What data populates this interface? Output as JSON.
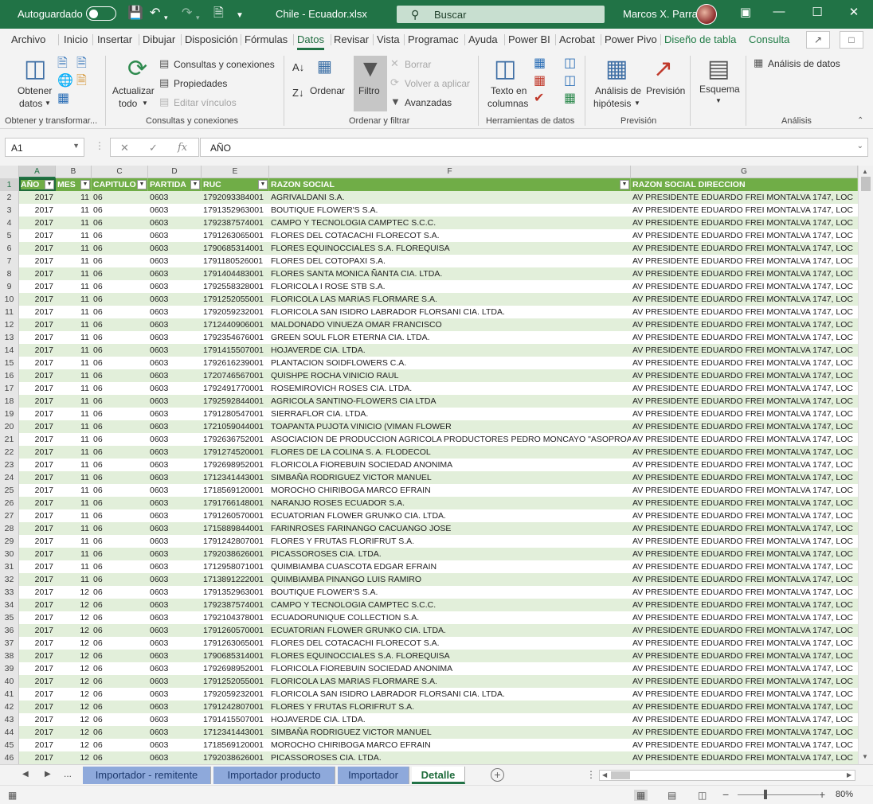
{
  "titlebar": {
    "autosave_label": "Autoguardado",
    "filename": "Chile - Ecuador.xlsx",
    "search_placeholder": "Buscar",
    "user_name": "Marcos X. Parra"
  },
  "ribbon_tabs": [
    "Archivo",
    "Inicio",
    "Insertar",
    "Dibujar",
    "Disposición",
    "Fórmulas",
    "Datos",
    "Revisar",
    "Vista",
    "Programac",
    "Ayuda",
    "Power BI",
    "Acrobat",
    "Power Pivo",
    "Diseño de tabla",
    "Consulta"
  ],
  "active_tab": "Datos",
  "ribbon": {
    "obtener_datos": "Obtener",
    "obtener_datos_2": "datos",
    "group_obtener": "Obtener y transformar...",
    "actualizar": "Actualizar",
    "actualizar_2": "todo",
    "consultas_conexiones": "Consultas y conexiones",
    "propiedades": "Propiedades",
    "editar_vinculos": "Editar vínculos",
    "group_consultas": "Consultas y conexiones",
    "ordenar": "Ordenar",
    "filtro": "Filtro",
    "borrar": "Borrar",
    "volver_aplicar": "Volver a aplicar",
    "avanzadas": "Avanzadas",
    "group_ordenar": "Ordenar y filtrar",
    "texto_columnas": "Texto en",
    "texto_columnas_2": "columnas",
    "group_herramientas": "Herramientas de datos",
    "analisis_hipotesis": "Análisis de",
    "analisis_hipotesis_2": "hipótesis",
    "prevision": "Previsión",
    "group_prevision": "Previsión",
    "esquema": "Esquema",
    "analisis_datos": "Análisis de datos",
    "group_analisis": "Análisis"
  },
  "formula_bar": {
    "name_box": "A1",
    "formula": "AÑO",
    "fx": "fx"
  },
  "columns": [
    {
      "letter": "A",
      "header": "AÑO"
    },
    {
      "letter": "B",
      "header": "MES"
    },
    {
      "letter": "C",
      "header": "CAPITULO"
    },
    {
      "letter": "D",
      "header": "PARTIDA"
    },
    {
      "letter": "E",
      "header": "RUC"
    },
    {
      "letter": "F",
      "header": "RAZON SOCIAL"
    },
    {
      "letter": "G",
      "header": "RAZON SOCIAL DIRECCION"
    }
  ],
  "address": "AV  PRESIDENTE EDUARDO FREI MONTALVA 1747, LOC",
  "rows": [
    [
      "2017",
      "11",
      "06",
      "0603",
      "1792093384001",
      "AGRIVALDANI S.A."
    ],
    [
      "2017",
      "11",
      "06",
      "0603",
      "1791352963001",
      "BOUTIQUE FLOWER'S S.A."
    ],
    [
      "2017",
      "11",
      "06",
      "0603",
      "1792387574001",
      "CAMPO Y TECNOLOGIA CAMPTEC S.C.C."
    ],
    [
      "2017",
      "11",
      "06",
      "0603",
      "1791263065001",
      "FLORES DEL COTACACHI FLORECOT S.A."
    ],
    [
      "2017",
      "11",
      "06",
      "0603",
      "1790685314001",
      "FLORES EQUINOCCIALES S.A. FLOREQUISA"
    ],
    [
      "2017",
      "11",
      "06",
      "0603",
      "1791180526001",
      "FLORES DEL COTOPAXI S.A."
    ],
    [
      "2017",
      "11",
      "06",
      "0603",
      "1791404483001",
      "FLORES SANTA MONICA ÑANTA CIA. LTDA."
    ],
    [
      "2017",
      "11",
      "06",
      "0603",
      "1792558328001",
      "FLORICOLA I ROSE STB S.A."
    ],
    [
      "2017",
      "11",
      "06",
      "0603",
      "1791252055001",
      "FLORICOLA LAS MARIAS FLORMARE S.A."
    ],
    [
      "2017",
      "11",
      "06",
      "0603",
      "1792059232001",
      "FLORICOLA SAN ISIDRO LABRADOR FLORSANI CIA. LTDA."
    ],
    [
      "2017",
      "11",
      "06",
      "0603",
      "1712440906001",
      "MALDONADO VINUEZA OMAR FRANCISCO"
    ],
    [
      "2017",
      "11",
      "06",
      "0603",
      "1792354676001",
      "GREEN SOUL FLOR ETERNA CIA. LTDA."
    ],
    [
      "2017",
      "11",
      "06",
      "0603",
      "1791415507001",
      "HOJAVERDE CIA. LTDA."
    ],
    [
      "2017",
      "11",
      "06",
      "0603",
      "1792616239001",
      "PLANTACION SOIDFLOWERS C.A."
    ],
    [
      "2017",
      "11",
      "06",
      "0603",
      "1720746567001",
      "QUISHPE ROCHA VINICIO RAUL"
    ],
    [
      "2017",
      "11",
      "06",
      "0603",
      "1792491770001",
      "ROSEMIROVICH ROSES CIA. LTDA."
    ],
    [
      "2017",
      "11",
      "06",
      "0603",
      "1792592844001",
      "AGRICOLA SANTINO-FLOWERS CIA LTDA"
    ],
    [
      "2017",
      "11",
      "06",
      "0603",
      "1791280547001",
      "SIERRAFLOR CIA. LTDA."
    ],
    [
      "2017",
      "11",
      "06",
      "0603",
      "1721059044001",
      "TOAPANTA PUJOTA VINICIO (VIMAN FLOWER"
    ],
    [
      "2017",
      "11",
      "06",
      "0603",
      "1792636752001",
      "ASOCIACION DE PRODUCCION AGRICOLA PRODUCTORES PEDRO MONCAYO \"ASOPROAGR"
    ],
    [
      "2017",
      "11",
      "06",
      "0603",
      "1791274520001",
      "FLORES DE LA COLINA S. A. FLODECOL"
    ],
    [
      "2017",
      "11",
      "06",
      "0603",
      "1792698952001",
      "FLORICOLA FIOREBUIN SOCIEDAD ANONIMA"
    ],
    [
      "2017",
      "11",
      "06",
      "0603",
      "1712341443001",
      "SIMBAÑA RODRIGUEZ VICTOR MANUEL"
    ],
    [
      "2017",
      "11",
      "06",
      "0603",
      "1718569120001",
      "MOROCHO CHIRIBOGA MARCO EFRAIN"
    ],
    [
      "2017",
      "11",
      "06",
      "0603",
      "1791766148001",
      "NARANJO ROSES ECUADOR S.A."
    ],
    [
      "2017",
      "11",
      "06",
      "0603",
      "1791260570001",
      "ECUATORIAN FLOWER GRUNKO CIA. LTDA."
    ],
    [
      "2017",
      "11",
      "06",
      "0603",
      "1715889844001",
      "FARINROSES FARINANGO CACUANGO JOSE"
    ],
    [
      "2017",
      "11",
      "06",
      "0603",
      "1791242807001",
      "FLORES Y FRUTAS FLORIFRUT S.A."
    ],
    [
      "2017",
      "11",
      "06",
      "0603",
      "1792038626001",
      "PICASSOROSES CIA. LTDA."
    ],
    [
      "2017",
      "11",
      "06",
      "0603",
      "1712958071001",
      "QUIMBIAMBA CUASCOTA EDGAR EFRAIN"
    ],
    [
      "2017",
      "11",
      "06",
      "0603",
      "1713891222001",
      "QUIMBIAMBA PINANGO LUIS RAMIRO"
    ],
    [
      "2017",
      "12",
      "06",
      "0603",
      "1791352963001",
      "BOUTIQUE FLOWER'S S.A."
    ],
    [
      "2017",
      "12",
      "06",
      "0603",
      "1792387574001",
      "CAMPO Y TECNOLOGIA CAMPTEC S.C.C."
    ],
    [
      "2017",
      "12",
      "06",
      "0603",
      "1792104378001",
      "ECUADORUNIQUE COLLECTION S.A."
    ],
    [
      "2017",
      "12",
      "06",
      "0603",
      "1791260570001",
      "ECUATORIAN FLOWER GRUNKO CIA. LTDA."
    ],
    [
      "2017",
      "12",
      "06",
      "0603",
      "1791263065001",
      "FLORES DEL COTACACHI FLORECOT S.A."
    ],
    [
      "2017",
      "12",
      "06",
      "0603",
      "1790685314001",
      "FLORES EQUINOCCIALES S.A. FLOREQUISA"
    ],
    [
      "2017",
      "12",
      "06",
      "0603",
      "1792698952001",
      "FLORICOLA FIOREBUIN SOCIEDAD ANONIMA"
    ],
    [
      "2017",
      "12",
      "06",
      "0603",
      "1791252055001",
      "FLORICOLA LAS MARIAS FLORMARE S.A."
    ],
    [
      "2017",
      "12",
      "06",
      "0603",
      "1792059232001",
      "FLORICOLA SAN ISIDRO LABRADOR FLORSANI CIA. LTDA."
    ],
    [
      "2017",
      "12",
      "06",
      "0603",
      "1791242807001",
      "FLORES Y FRUTAS FLORIFRUT S.A."
    ],
    [
      "2017",
      "12",
      "06",
      "0603",
      "1791415507001",
      "HOJAVERDE CIA. LTDA."
    ],
    [
      "2017",
      "12",
      "06",
      "0603",
      "1712341443001",
      "SIMBAÑA RODRIGUEZ VICTOR MANUEL"
    ],
    [
      "2017",
      "12",
      "06",
      "0603",
      "1718569120001",
      "MOROCHO CHIRIBOGA MARCO EFRAIN"
    ],
    [
      "2017",
      "12",
      "06",
      "0603",
      "1792038626001",
      "PICASSOROSES CIA. LTDA."
    ]
  ],
  "sheet_tabs": [
    "Importador - remitente",
    "Importador producto",
    "Importador",
    "Detalle"
  ],
  "active_sheet": "Detalle",
  "sheet_nav_more": "...",
  "zoom": "80%",
  "colors": {
    "excel_green": "#217346",
    "table_header": "#70ad47",
    "band_row": "#e2efda",
    "sheet_tab": "#8ea9db"
  }
}
